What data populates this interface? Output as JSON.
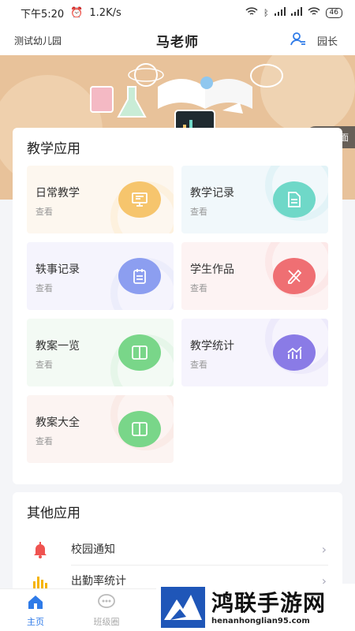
{
  "status_bar": {
    "time": "下午5:20",
    "speed": "1.2K/s",
    "battery": "46"
  },
  "header": {
    "school": "测试幼儿园",
    "title": "马老师",
    "role": "园长"
  },
  "cover": {
    "change_label": "更换封面"
  },
  "teaching_apps": {
    "title": "教学应用",
    "items": [
      {
        "name": "日常教学",
        "sub": "查看",
        "icon": "board-icon",
        "color": "#f6c56d"
      },
      {
        "name": "教学记录",
        "sub": "查看",
        "icon": "document-icon",
        "color": "#6fd8c8"
      },
      {
        "name": "轶事记录",
        "sub": "查看",
        "icon": "clipboard-icon",
        "color": "#8c9ef0"
      },
      {
        "name": "学生作品",
        "sub": "查看",
        "icon": "pencil-ruler-icon",
        "color": "#ef6f73"
      },
      {
        "name": "教案一览",
        "sub": "查看",
        "icon": "book-icon",
        "color": "#79d689"
      },
      {
        "name": "教学统计",
        "sub": "查看",
        "icon": "chart-icon",
        "color": "#8a7be6"
      },
      {
        "name": "教案大全",
        "sub": "查看",
        "icon": "book-icon",
        "color": "#79d689"
      }
    ]
  },
  "other_apps": {
    "title": "其他应用",
    "items": [
      {
        "label": "校园通知",
        "icon": "bell-icon",
        "color": "#ef5350"
      },
      {
        "label": "出勤率统计",
        "icon": "bar-chart-icon",
        "color": "#f5b400"
      }
    ]
  },
  "bottom_nav": [
    {
      "label": "主页",
      "icon": "home-icon",
      "active": true
    },
    {
      "label": "班级圈",
      "icon": "chat-icon",
      "active": false
    }
  ],
  "watermark": {
    "title": "鸿联手游网",
    "url": "henanhonglian95.com"
  }
}
